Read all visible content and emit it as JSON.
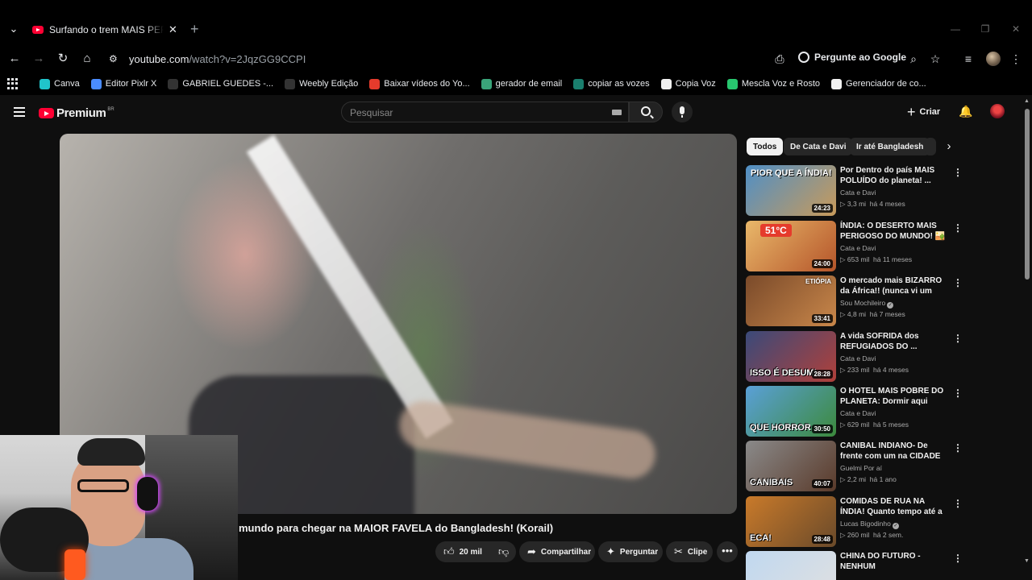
{
  "browser": {
    "tab_title": "Surfando o trem MAIS PERIGOSO",
    "url_host": "youtube.com",
    "url_path": "/watch?v=2JqzGG9CCPI",
    "ask_google_label": "Pergunte ao Google",
    "bookmarks": [
      {
        "label": "Canva",
        "color": "#20c4cb"
      },
      {
        "label": "Editor Pixlr X",
        "color": "#4a8cff"
      },
      {
        "label": "GABRIEL GUEDES -...",
        "color": "#333333"
      },
      {
        "label": "Weebly Edição",
        "color": "#333333"
      },
      {
        "label": "Baixar vídeos do Yo...",
        "color": "#e53b2c"
      },
      {
        "label": "gerador de email",
        "color": "#3aa57a"
      },
      {
        "label": "copiar as vozes",
        "color": "#1a7f6e"
      },
      {
        "label": "Copia Voz",
        "color": "#f1f1f1"
      },
      {
        "label": "Mescla Voz e Rosto",
        "color": "#28c76f"
      },
      {
        "label": "Gerenciador de co...",
        "color": "#f1f1f1"
      }
    ]
  },
  "youtube": {
    "logo_text": "Premium",
    "logo_region": "BR",
    "search_placeholder": "Pesquisar",
    "create_label": "Criar",
    "video_title": "mundo para chegar na MAIOR FAVELA do Bangladesh! (Korail)",
    "actions": {
      "like_count": "20 mil",
      "share": "Compartilhar",
      "ask": "Perguntar",
      "clip": "Clipe"
    },
    "chips": [
      "Todos",
      "De Cata e Davi",
      "Ir até Bangladesh"
    ],
    "recommendations": [
      {
        "title": "Por Dentro do país MAIS POLUÍDO do planeta! ...",
        "channel": "Cata e Davi",
        "verified": false,
        "views": "3,3 mi",
        "age": "há 4 meses",
        "duration": "24:23",
        "thumb_text": "PIOR QUE A ÍNDIA!",
        "thumb_colors": [
          "#4f8fc6",
          "#c89a5a"
        ]
      },
      {
        "title": "ÍNDIA: O DESERTO MAIS PERIGOSO DO MUNDO! 🏜️ ...",
        "channel": "Cata e Davi",
        "verified": false,
        "views": "653 mil",
        "age": "há 11 meses",
        "duration": "24:00",
        "thumb_text": "51°C",
        "thumb_colors": [
          "#e9b86a",
          "#b5552a"
        ]
      },
      {
        "title": "O mercado mais BIZARRO da África!! (nunca vi um lugar ...",
        "channel": "Sou Mochileiro",
        "verified": true,
        "views": "4,8 mi",
        "age": "há 7 meses",
        "duration": "33:41",
        "thumb_text": "ETIÓPIA",
        "thumb_colors": [
          "#7a4a2a",
          "#c9874a"
        ]
      },
      {
        "title": "A vida SOFRIDA dos REFUGIADOS DO ...",
        "channel": "Cata e Davi",
        "verified": false,
        "views": "233 mil",
        "age": "há 4 meses",
        "duration": "28:28",
        "thumb_text": "ISSO É DESUMI...",
        "thumb_colors": [
          "#3a4a7a",
          "#b0403a"
        ]
      },
      {
        "title": "O HOTEL MAIS POBRE DO PLANETA: Dormir aqui custa ...",
        "channel": "Cata e Davi",
        "verified": false,
        "views": "629 mil",
        "age": "há 5 meses",
        "duration": "30:50",
        "thumb_text": "QUE HORROR",
        "thumb_colors": [
          "#5aa0d8",
          "#3c8a3c"
        ]
      },
      {
        "title": "CANIBAL INDIANO- De frente com um na CIDADE DA MORTE",
        "channel": "Guelmi Por aí",
        "verified": false,
        "views": "2,2 mi",
        "age": "há 1 ano",
        "duration": "40:07",
        "thumb_text": "CANIBAIS",
        "thumb_colors": [
          "#8a8a8a",
          "#5a3a2a"
        ]
      },
      {
        "title": "COMIDAS DE RUA NA ÍNDIA! Quanto tempo até a ...",
        "channel": "Lucas Bigodinho",
        "verified": true,
        "views": "260 mil",
        "age": "há 2 sem.",
        "duration": "28:48",
        "thumb_text": "ECA!",
        "thumb_colors": [
          "#c97a2a",
          "#6a4a2a"
        ]
      },
      {
        "title": "CHINA DO FUTURO - NENHUM",
        "channel": "",
        "verified": false,
        "views": "",
        "age": "",
        "duration": "",
        "thumb_text": "",
        "thumb_colors": [
          "#c0d8f0",
          "#e0e0e0"
        ]
      }
    ]
  }
}
